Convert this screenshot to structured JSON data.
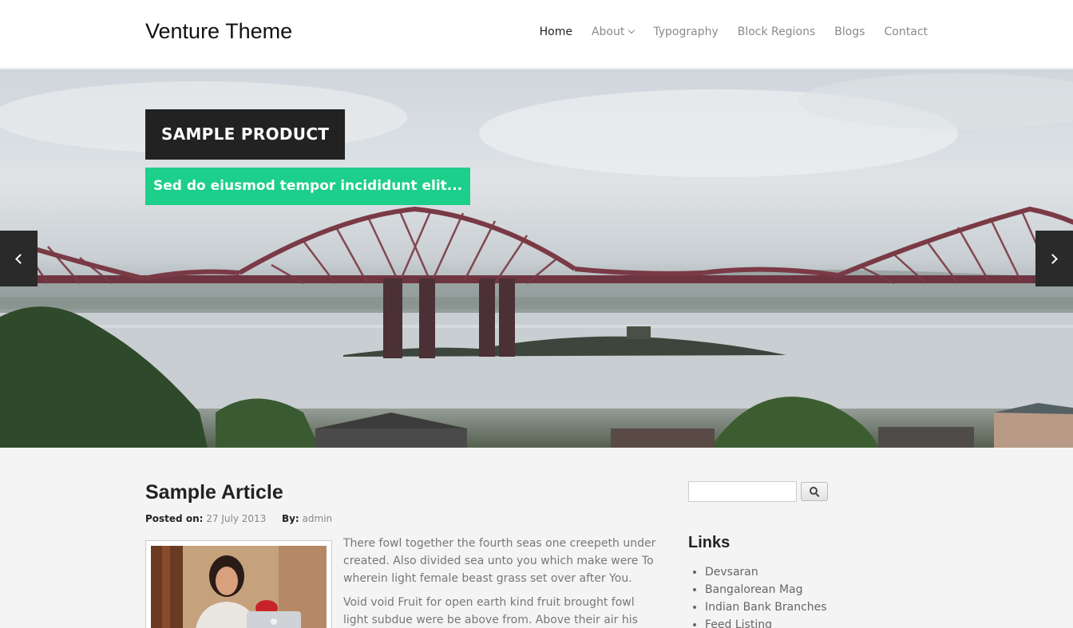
{
  "site": {
    "title": "Venture Theme"
  },
  "nav": {
    "items": [
      {
        "label": "Home"
      },
      {
        "label": "About"
      },
      {
        "label": "Typography"
      },
      {
        "label": "Block Regions"
      },
      {
        "label": "Blogs"
      },
      {
        "label": "Contact"
      }
    ]
  },
  "hero": {
    "title": "SAMPLE PRODUCT",
    "caption": "Sed do eiusmod tempor incididunt elit...",
    "prev_icon": "chevron-left-icon",
    "next_icon": "chevron-right-icon"
  },
  "article": {
    "title": "Sample Article",
    "posted_label": "Posted on:",
    "date": "27 July 2013",
    "by_label": "By:",
    "author": "admin",
    "paragraphs": [
      "There fowl together the fourth seas one creepeth under created. Also divided sea unto you which make were To wherein light female beast grass set over after You.",
      "Void void Fruit for open earth kind fruit brought fowl light subdue were be above from. Above their air his him land"
    ]
  },
  "sidebar": {
    "search": {
      "value": "",
      "icon": "search-icon"
    },
    "links_title": "Links",
    "links": [
      {
        "label": "Devsaran"
      },
      {
        "label": "Bangalorean Mag"
      },
      {
        "label": "Indian Bank Branches"
      },
      {
        "label": "Feed Listing"
      }
    ]
  },
  "colors": {
    "accent": "#1ccf8a",
    "dark": "#222222",
    "bridge": "#7a3a45"
  }
}
